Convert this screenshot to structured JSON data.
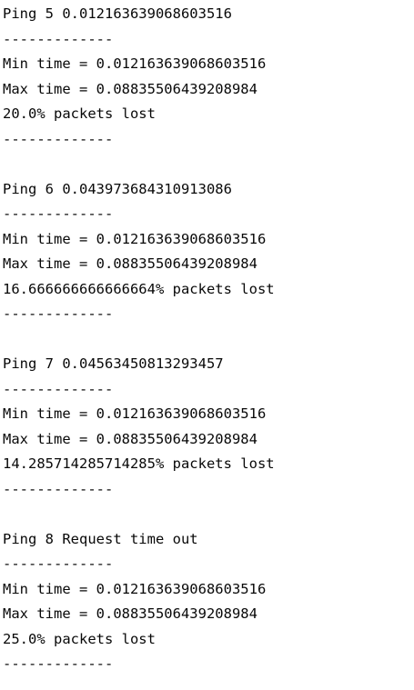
{
  "console": {
    "blocks": [
      {
        "ping": "Ping 5 0.012163639068603516",
        "separator_top": "-------------",
        "min_time": "Min time = 0.012163639068603516",
        "max_time": "Max time = 0.08835506439208984",
        "packets_lost": "20.0% packets lost",
        "separator_bottom": "-------------"
      },
      {
        "ping": "Ping 6 0.043973684310913086",
        "separator_top": "-------------",
        "min_time": "Min time = 0.012163639068603516",
        "max_time": "Max time = 0.08835506439208984",
        "packets_lost": "16.666666666666664% packets lost",
        "separator_bottom": "-------------"
      },
      {
        "ping": "Ping 7 0.04563450813293457",
        "separator_top": "-------------",
        "min_time": "Min time = 0.012163639068603516",
        "max_time": "Max time = 0.08835506439208984",
        "packets_lost": "14.285714285714285% packets lost",
        "separator_bottom": "-------------"
      },
      {
        "ping": "Ping 8 Request time out",
        "separator_top": "-------------",
        "min_time": "Min time = 0.012163639068603516",
        "max_time": "Max time = 0.08835506439208984",
        "packets_lost": "25.0% packets lost",
        "separator_bottom": "-------------"
      }
    ]
  }
}
